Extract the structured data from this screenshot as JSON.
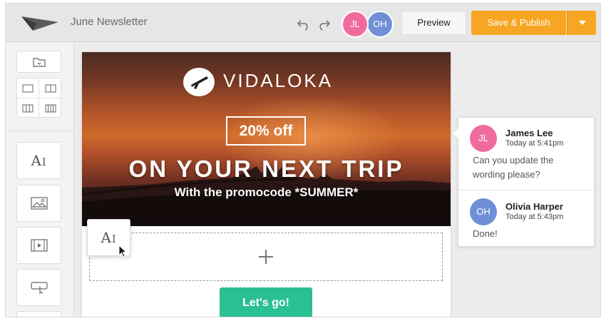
{
  "header": {
    "doc_title": "June Newsletter",
    "collaborators": [
      {
        "initials": "JL",
        "color": "#f06b9d"
      },
      {
        "initials": "OH",
        "color": "#6f8fd6"
      }
    ],
    "preview_label": "Preview",
    "publish_label": "Save & Publish",
    "accent_color": "#f6a623"
  },
  "sidebar": {
    "tools": [
      "folder-icon",
      "one-column-layout-icon",
      "two-column-layout-icon",
      "three-column-layout-icon",
      "four-column-layout-icon",
      "text-block-icon",
      "image-block-icon",
      "video-block-icon",
      "button-block-icon"
    ],
    "text_tool_glyph": "A",
    "text_tool_cursor": "I"
  },
  "email": {
    "brand": "VIDALOKA",
    "offer": "20% off",
    "headline": "ON YOUR NEXT TRIP",
    "subline": "With the promocode *SUMMER*",
    "cta_label": "Let's go!",
    "cta_color": "#2bbf94"
  },
  "comments": [
    {
      "initials": "JL",
      "author": "James Lee",
      "time": "Today at 5:41pm",
      "text": "Can you update the wording please?",
      "color": "#f06b9d"
    },
    {
      "initials": "OH",
      "author": "Olivia Harper",
      "time": "Today at 5:43pm",
      "text": "Done!",
      "color": "#6f8fd6"
    }
  ]
}
